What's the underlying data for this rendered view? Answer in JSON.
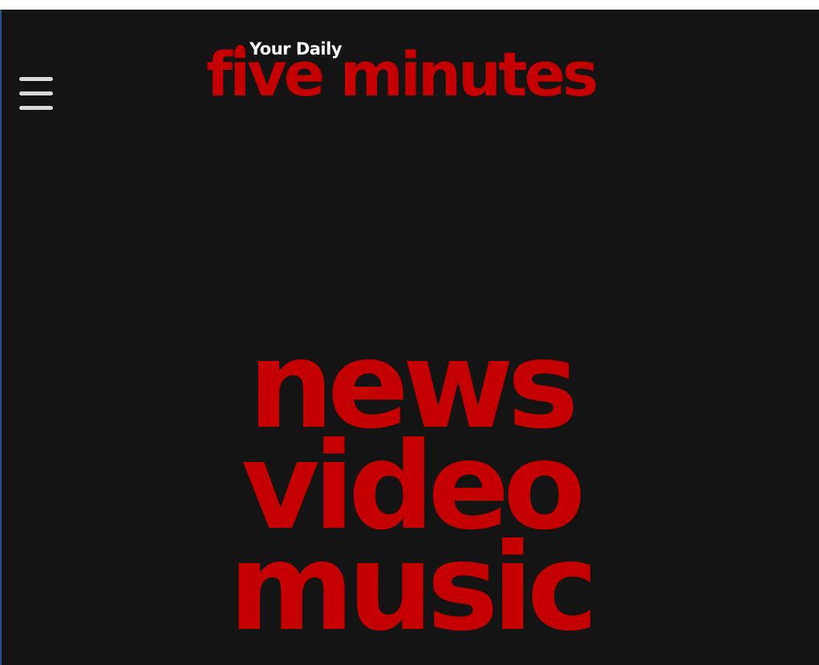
{
  "brand": {
    "tagline": "Your Daily",
    "name": "five minutes",
    "primary_color": "#c40000",
    "tagline_color": "#ffffff"
  },
  "header": {
    "menu_icon": "hamburger-menu-icon"
  },
  "hero": {
    "words": [
      "news",
      "video",
      "music"
    ]
  },
  "colors": {
    "background": "#141414",
    "menu_icon": "#d8d8d8"
  }
}
